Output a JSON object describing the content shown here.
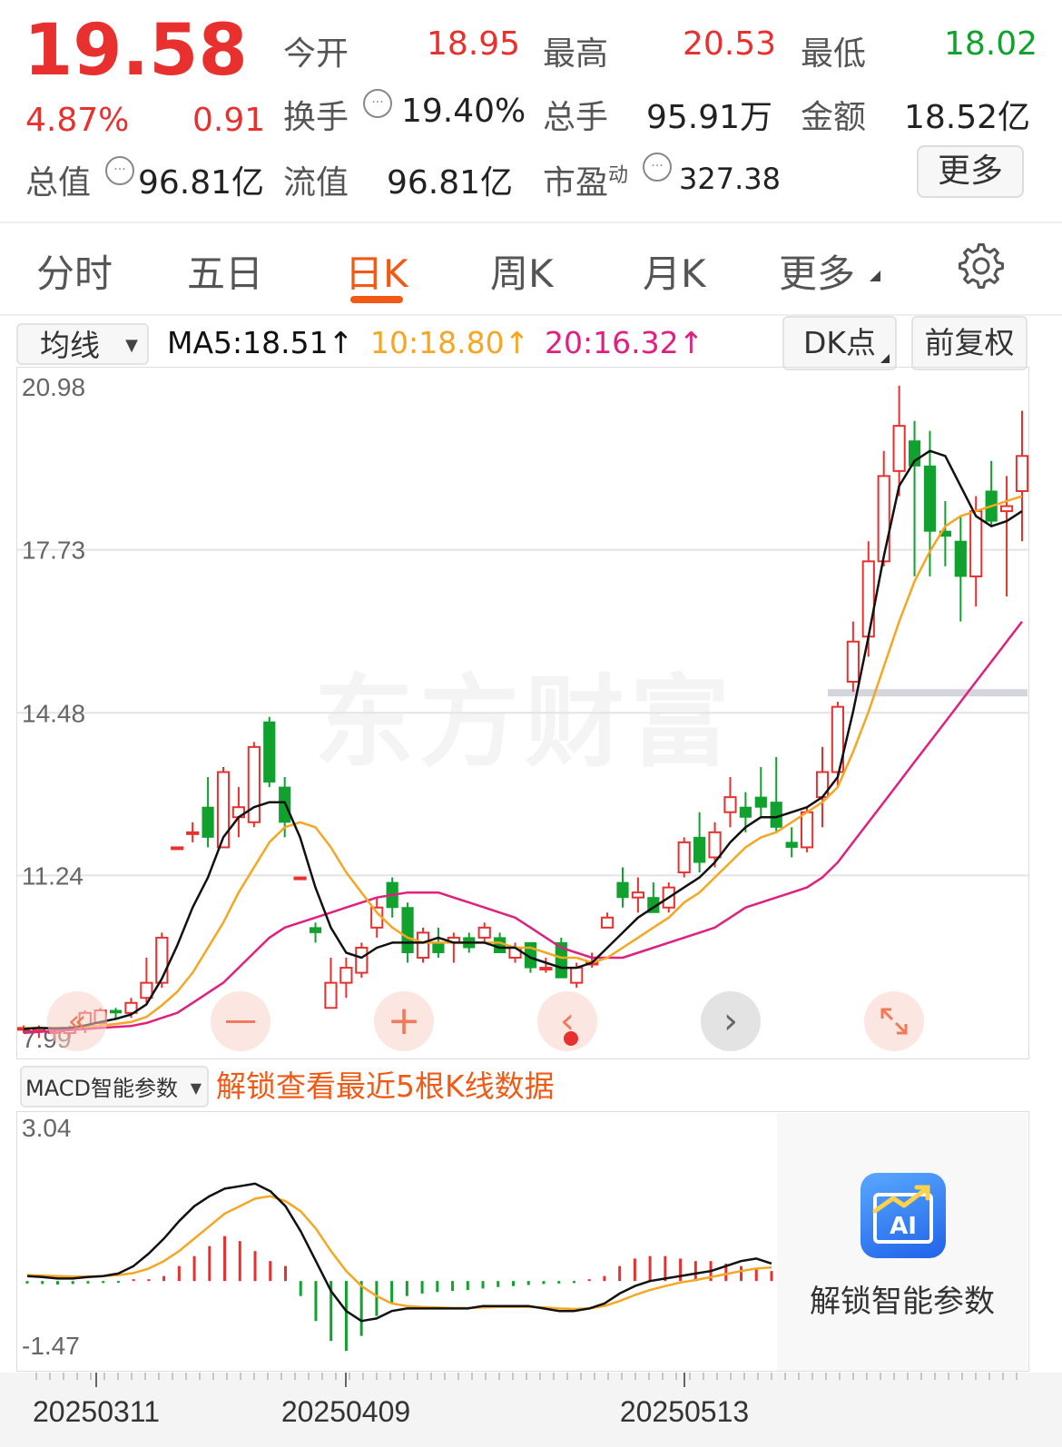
{
  "quote": {
    "price": "19.58",
    "pct": "4.87%",
    "change": "0.91",
    "open_label": "今开",
    "open": "18.95",
    "high_label": "最高",
    "high": "20.53",
    "low_label": "最低",
    "low": "18.02",
    "turnover_label": "换手",
    "turnover": "19.40%",
    "volume_label": "总手",
    "volume": "95.91万",
    "amount_label": "金额",
    "amount": "18.52亿",
    "mktcap_label": "总值",
    "mktcap": "96.81亿",
    "float_label": "流值",
    "float": "96.81亿",
    "pe_label": "市盈",
    "pe_sup": "动",
    "pe": "327.38",
    "more_label": "更多"
  },
  "tabs": [
    {
      "label": "分时"
    },
    {
      "label": "五日"
    },
    {
      "label": "日K"
    },
    {
      "label": "周K"
    },
    {
      "label": "月K"
    },
    {
      "label": "更多"
    }
  ],
  "ma_bar": {
    "select": "均线",
    "ma5": "MA5:18.51↑",
    "ma10": "10:18.80↑",
    "ma20": "20:16.32↑",
    "dk_label": "DK点",
    "fq_label": "前复权"
  },
  "macd_bar": {
    "select": "MACD智能参数",
    "unlock_text": "解锁查看最近5根K线数据"
  },
  "watermark": "东方财富",
  "unlock_panel": {
    "icon_text": "AI",
    "label": "解锁智能参数"
  },
  "colors": {
    "up": "#e8312f",
    "down": "#10a12e",
    "ma5": "#111111",
    "ma10": "#f5a623",
    "ma20": "#e0207f",
    "accent": "#f05a14"
  },
  "chart_data": [
    {
      "type": "candlestick",
      "y_ticks": [
        "20.98",
        "17.73",
        "14.48",
        "11.24",
        "7.99"
      ],
      "ylim": [
        7.99,
        20.98
      ],
      "candles": [
        [
          8.2,
          8.25,
          8.1,
          8.2
        ],
        [
          8.15,
          8.25,
          8.0,
          8.2
        ],
        [
          8.1,
          8.2,
          8.0,
          8.15
        ],
        [
          8.1,
          8.25,
          8.0,
          8.2
        ],
        [
          8.2,
          8.55,
          8.1,
          8.5
        ],
        [
          8.3,
          8.6,
          8.2,
          8.55
        ],
        [
          8.55,
          8.6,
          8.4,
          8.5
        ],
        [
          8.5,
          8.8,
          8.4,
          8.7
        ],
        [
          8.8,
          9.6,
          8.7,
          9.1
        ],
        [
          9.1,
          10.1,
          9.0,
          10.0
        ],
        [
          11.8,
          11.8,
          11.8,
          11.8
        ],
        [
          12.1,
          12.3,
          11.9,
          12.1
        ],
        [
          12.6,
          13.2,
          11.8,
          12.0
        ],
        [
          11.8,
          13.4,
          11.8,
          13.3
        ],
        [
          12.4,
          13.0,
          12.0,
          12.6
        ],
        [
          12.3,
          13.9,
          12.2,
          13.8
        ],
        [
          14.3,
          14.4,
          13.0,
          13.1
        ],
        [
          13.0,
          13.2,
          12.0,
          12.3
        ],
        [
          11.2,
          11.2,
          11.2,
          11.2
        ],
        [
          10.2,
          10.3,
          9.9,
          10.1
        ],
        [
          8.6,
          9.6,
          8.6,
          9.1
        ],
        [
          9.1,
          9.6,
          8.8,
          9.4
        ],
        [
          9.3,
          9.9,
          9.2,
          9.8
        ],
        [
          10.2,
          10.8,
          10.0,
          10.6
        ],
        [
          11.1,
          11.2,
          10.4,
          10.6
        ],
        [
          10.6,
          10.7,
          9.5,
          9.7
        ],
        [
          9.6,
          10.2,
          9.5,
          10.1
        ],
        [
          9.9,
          10.2,
          9.6,
          9.7
        ],
        [
          9.9,
          10.1,
          9.5,
          10.0
        ],
        [
          10.0,
          10.1,
          9.7,
          9.8
        ],
        [
          10.0,
          10.3,
          9.9,
          10.2
        ],
        [
          10.0,
          10.1,
          9.7,
          9.7
        ],
        [
          9.6,
          9.9,
          9.5,
          9.8
        ],
        [
          9.9,
          9.9,
          9.3,
          9.4
        ],
        [
          9.4,
          9.6,
          9.3,
          9.4
        ],
        [
          9.9,
          10.0,
          9.2,
          9.2
        ],
        [
          9.1,
          9.5,
          9.0,
          9.4
        ],
        [
          9.5,
          9.7,
          9.4,
          9.5
        ],
        [
          10.2,
          10.5,
          10.2,
          10.4
        ],
        [
          11.1,
          11.4,
          10.6,
          10.8
        ],
        [
          10.8,
          11.2,
          10.5,
          10.9
        ],
        [
          10.8,
          11.1,
          10.5,
          10.5
        ],
        [
          10.6,
          11.1,
          10.5,
          11.0
        ],
        [
          11.3,
          12.0,
          11.2,
          11.9
        ],
        [
          12.0,
          12.5,
          11.3,
          11.5
        ],
        [
          11.6,
          12.3,
          11.4,
          12.1
        ],
        [
          12.5,
          13.2,
          12.2,
          12.8
        ],
        [
          12.6,
          12.9,
          12.1,
          12.4
        ],
        [
          12.8,
          13.4,
          12.4,
          12.6
        ],
        [
          12.7,
          13.6,
          12.1,
          12.2
        ],
        [
          11.9,
          12.2,
          11.6,
          11.8
        ],
        [
          11.8,
          12.6,
          11.7,
          12.5
        ],
        [
          12.8,
          13.8,
          12.2,
          13.3
        ],
        [
          13.3,
          14.7,
          13.0,
          14.6
        ],
        [
          15.1,
          16.3,
          14.9,
          15.9
        ],
        [
          16.0,
          17.9,
          15.6,
          17.5
        ],
        [
          17.5,
          19.7,
          17.4,
          19.2
        ],
        [
          19.3,
          21.0,
          18.8,
          20.2
        ],
        [
          19.9,
          20.3,
          17.2,
          19.4
        ],
        [
          19.4,
          20.1,
          17.2,
          18.1
        ],
        [
          18.1,
          18.7,
          17.4,
          18.0
        ],
        [
          17.9,
          18.4,
          16.3,
          17.2
        ],
        [
          17.2,
          18.8,
          16.6,
          18.5
        ],
        [
          18.9,
          19.5,
          18.2,
          18.3
        ],
        [
          18.5,
          19.2,
          16.8,
          18.6
        ],
        [
          18.9,
          20.5,
          17.9,
          19.6
        ]
      ],
      "ma5": [
        8.18,
        8.2,
        8.19,
        8.2,
        8.25,
        8.32,
        8.38,
        8.47,
        8.67,
        9.18,
        9.84,
        10.6,
        11.2,
        12.0,
        12.4,
        12.6,
        12.7,
        12.7,
        12.0,
        11.0,
        10.2,
        9.7,
        9.6,
        9.8,
        9.9,
        9.9,
        9.9,
        10.0,
        9.9,
        9.9,
        9.9,
        9.8,
        9.8,
        9.6,
        9.5,
        9.4,
        9.4,
        9.5,
        9.8,
        10.1,
        10.4,
        10.6,
        10.8,
        11.0,
        11.2,
        11.5,
        11.9,
        12.2,
        12.4,
        12.4,
        12.5,
        12.6,
        12.8,
        13.2,
        14.5,
        16.0,
        17.6,
        19.0,
        19.5,
        19.7,
        19.6,
        19.0,
        18.4,
        18.2,
        18.3,
        18.5
      ],
      "ma10": [
        8.2,
        8.2,
        8.2,
        8.2,
        8.22,
        8.25,
        8.28,
        8.32,
        8.42,
        8.65,
        8.92,
        9.3,
        9.8,
        10.3,
        10.9,
        11.4,
        11.9,
        12.2,
        12.3,
        12.2,
        11.8,
        11.3,
        10.9,
        10.5,
        10.2,
        10.0,
        9.9,
        9.9,
        9.9,
        9.9,
        9.9,
        9.9,
        9.8,
        9.8,
        9.7,
        9.6,
        9.6,
        9.5,
        9.6,
        9.8,
        10.0,
        10.2,
        10.4,
        10.7,
        10.9,
        11.2,
        11.5,
        11.8,
        12.0,
        12.1,
        12.3,
        12.5,
        12.7,
        13.0,
        13.7,
        14.5,
        15.4,
        16.3,
        17.1,
        17.7,
        18.2,
        18.4,
        18.5,
        18.6,
        18.7,
        18.8
      ],
      "ma20": [
        8.1,
        8.12,
        8.14,
        8.16,
        8.18,
        8.2,
        8.22,
        8.24,
        8.3,
        8.4,
        8.5,
        8.7,
        8.9,
        9.1,
        9.4,
        9.7,
        10.0,
        10.2,
        10.3,
        10.4,
        10.5,
        10.6,
        10.7,
        10.8,
        10.85,
        10.9,
        10.9,
        10.9,
        10.8,
        10.7,
        10.6,
        10.5,
        10.4,
        10.2,
        10.0,
        9.8,
        9.7,
        9.6,
        9.6,
        9.6,
        9.7,
        9.8,
        9.9,
        10.0,
        10.1,
        10.2,
        10.4,
        10.6,
        10.7,
        10.8,
        10.9,
        11.0,
        11.2,
        11.5,
        11.9,
        12.3,
        12.7,
        13.1,
        13.5,
        13.9,
        14.3,
        14.7,
        15.1,
        15.5,
        15.9,
        16.3
      ]
    },
    {
      "type": "bar",
      "title": "MACD",
      "y_ticks": [
        "3.04",
        "-1.47"
      ],
      "ylim": [
        -1.47,
        3.04
      ],
      "categories": [
        "20250311",
        "20250409",
        "20250513"
      ],
      "histogram": [
        -0.05,
        -0.06,
        -0.07,
        -0.06,
        -0.05,
        -0.04,
        -0.03,
        0.0,
        0.02,
        0.1,
        0.3,
        0.5,
        0.7,
        0.9,
        0.8,
        0.6,
        0.4,
        0.3,
        -0.3,
        -0.8,
        -1.2,
        -1.4,
        -1.1,
        -0.7,
        -0.45,
        -0.3,
        -0.25,
        -0.22,
        -0.2,
        -0.18,
        -0.15,
        -0.12,
        -0.1,
        -0.08,
        -0.06,
        -0.05,
        -0.04,
        0.03,
        0.1,
        0.3,
        0.45,
        0.5,
        0.5,
        0.45,
        0.4,
        0.4,
        0.35,
        0.3,
        0.25,
        0.2
      ],
      "dif": [
        0.1,
        0.08,
        0.05,
        0.05,
        0.08,
        0.1,
        0.15,
        0.3,
        0.55,
        0.85,
        1.2,
        1.5,
        1.7,
        1.85,
        1.9,
        1.95,
        1.8,
        1.5,
        1.0,
        0.4,
        -0.2,
        -0.6,
        -0.8,
        -0.75,
        -0.6,
        -0.55,
        -0.55,
        -0.55,
        -0.55,
        -0.55,
        -0.5,
        -0.5,
        -0.5,
        -0.5,
        -0.55,
        -0.6,
        -0.6,
        -0.55,
        -0.45,
        -0.25,
        -0.1,
        0.0,
        0.05,
        0.1,
        0.15,
        0.2,
        0.3,
        0.4,
        0.45,
        0.35
      ],
      "dea": [
        0.12,
        0.11,
        0.1,
        0.09,
        0.09,
        0.1,
        0.12,
        0.16,
        0.25,
        0.4,
        0.6,
        0.85,
        1.1,
        1.35,
        1.5,
        1.65,
        1.7,
        1.6,
        1.4,
        1.05,
        0.6,
        0.2,
        -0.1,
        -0.3,
        -0.45,
        -0.5,
        -0.52,
        -0.53,
        -0.54,
        -0.54,
        -0.53,
        -0.52,
        -0.52,
        -0.52,
        -0.53,
        -0.55,
        -0.56,
        -0.55,
        -0.5,
        -0.4,
        -0.28,
        -0.18,
        -0.1,
        -0.03,
        0.02,
        0.08,
        0.14,
        0.2,
        0.25,
        0.27
      ]
    }
  ]
}
